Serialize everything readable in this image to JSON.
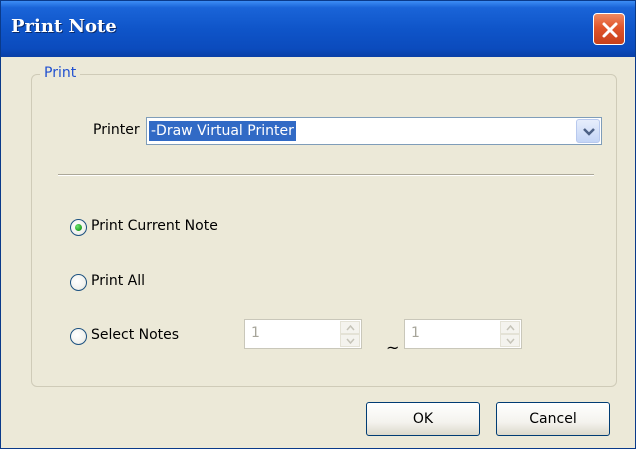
{
  "window": {
    "title": "Print Note"
  },
  "group": {
    "legend": "Print"
  },
  "printer": {
    "label": "Printer",
    "value": "-Draw Virtual Printer"
  },
  "options": [
    {
      "label": "Print Current Note",
      "selected": true
    },
    {
      "label": "Print All",
      "selected": false
    },
    {
      "label": "Select Notes",
      "selected": false
    }
  ],
  "range": {
    "from": "1",
    "separator": "~",
    "to": "1"
  },
  "buttons": {
    "ok": "OK",
    "cancel": "Cancel"
  },
  "colors": {
    "title_bar": "#0f55c9",
    "legend_text": "#2050d0",
    "selection": "#316ac5",
    "close_button": "#e0552c"
  }
}
